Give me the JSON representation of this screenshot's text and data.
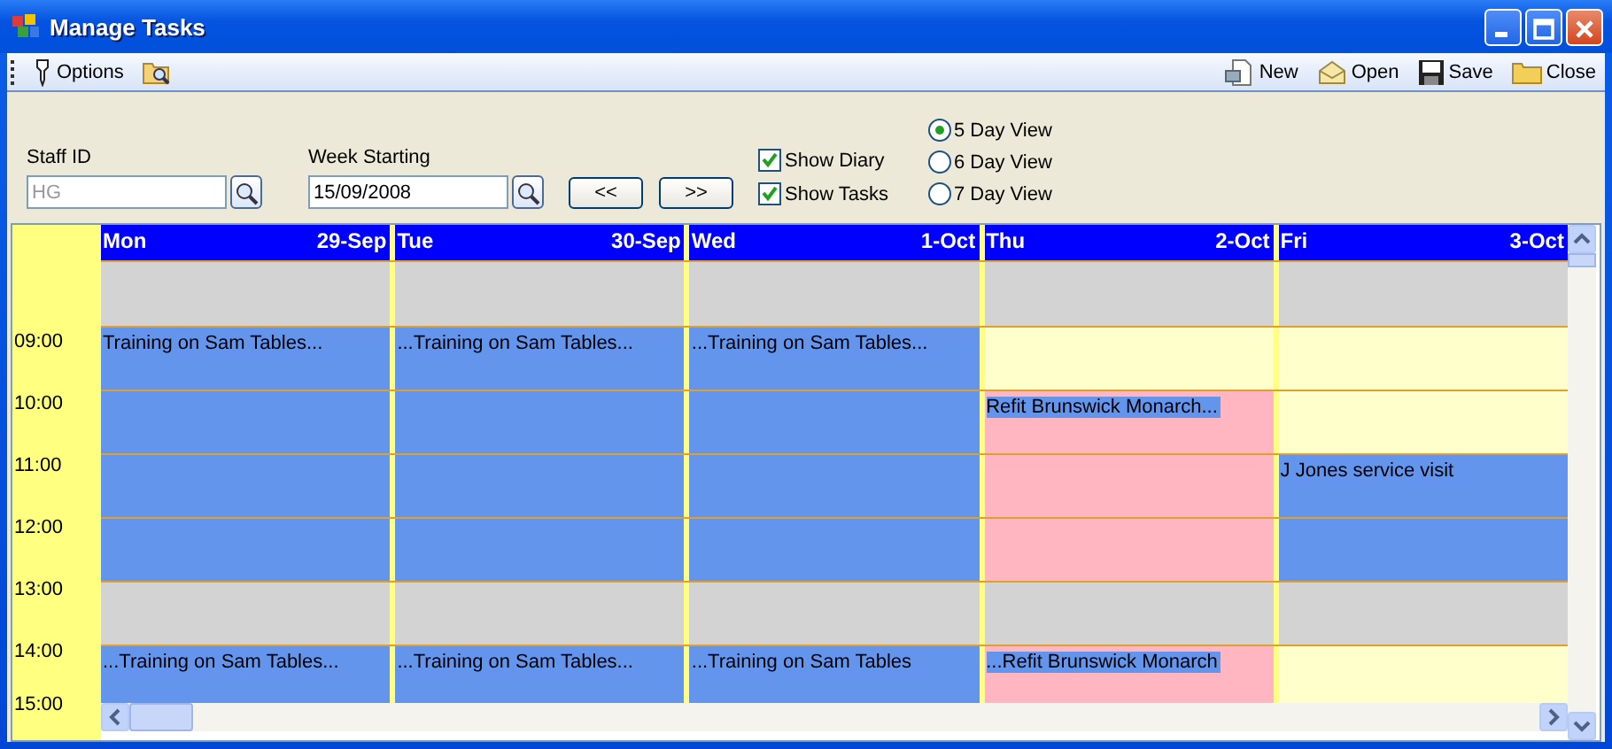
{
  "window": {
    "title": "Manage Tasks"
  },
  "toolbar": {
    "options": {
      "label": "Options"
    },
    "actions": [
      {
        "label": "New"
      },
      {
        "label": "Open"
      },
      {
        "label": "Save"
      },
      {
        "label": "Close"
      }
    ]
  },
  "form": {
    "staff_id": {
      "label": "Staff ID",
      "value": "HG",
      "disabled": true
    },
    "week_starting": {
      "label": "Week Starting",
      "value": "15/09/2008",
      "disabled": false
    },
    "nav_buttons": [
      "<<",
      ">>"
    ],
    "checkboxes": [
      {
        "label": "Show Diary",
        "checked": true
      },
      {
        "label": "Show Tasks",
        "checked": true
      }
    ],
    "view_options": [
      {
        "label": "5 Day View",
        "selected": true
      },
      {
        "label": "6 Day View",
        "selected": false
      },
      {
        "label": "7 Day View",
        "selected": false
      }
    ]
  },
  "calendar": {
    "days": [
      {
        "name": "Mon",
        "date": "29-Sep"
      },
      {
        "name": "Tue",
        "date": "30-Sep"
      },
      {
        "name": "Wed",
        "date": "1-Oct"
      },
      {
        "name": "Thu",
        "date": "2-Oct"
      },
      {
        "name": "Fri",
        "date": "3-Oct"
      }
    ],
    "rows": [
      {
        "cells": [
          {
            "kind": "off"
          },
          {
            "kind": "off"
          },
          {
            "kind": "off"
          },
          {
            "kind": "off"
          },
          {
            "kind": "off"
          }
        ]
      },
      {
        "time": "09:00",
        "cells": [
          {
            "kind": "task",
            "text": "Training on Sam Tables..."
          },
          {
            "kind": "task",
            "text": "...Training on Sam Tables..."
          },
          {
            "kind": "task",
            "text": "...Training on Sam Tables..."
          },
          {
            "kind": "free"
          },
          {
            "kind": "free"
          }
        ]
      },
      {
        "time": "10:00",
        "cells": [
          {
            "kind": "task"
          },
          {
            "kind": "task"
          },
          {
            "kind": "task"
          },
          {
            "kind": "busy",
            "text": "Refit Brunswick Monarch...",
            "highlighted": true
          },
          {
            "kind": "free"
          }
        ]
      },
      {
        "time": "11:00",
        "cells": [
          {
            "kind": "task"
          },
          {
            "kind": "task"
          },
          {
            "kind": "task"
          },
          {
            "kind": "busy"
          },
          {
            "kind": "task",
            "text": "J Jones service visit"
          }
        ]
      },
      {
        "time": "12:00",
        "cells": [
          {
            "kind": "task"
          },
          {
            "kind": "task"
          },
          {
            "kind": "task"
          },
          {
            "kind": "busy"
          },
          {
            "kind": "task"
          }
        ]
      },
      {
        "time": "13:00",
        "cells": [
          {
            "kind": "off"
          },
          {
            "kind": "off"
          },
          {
            "kind": "off"
          },
          {
            "kind": "off"
          },
          {
            "kind": "off"
          }
        ]
      },
      {
        "time": "14:00",
        "cells": [
          {
            "kind": "task",
            "text": "...Training on Sam Tables..."
          },
          {
            "kind": "task",
            "text": "...Training on Sam Tables..."
          },
          {
            "kind": "task",
            "text": "...Training on Sam Tables"
          },
          {
            "kind": "busy",
            "text": "...Refit Brunswick Monarch",
            "highlighted": true
          },
          {
            "kind": "free"
          }
        ]
      }
    ],
    "footer_time": "15:00"
  }
}
